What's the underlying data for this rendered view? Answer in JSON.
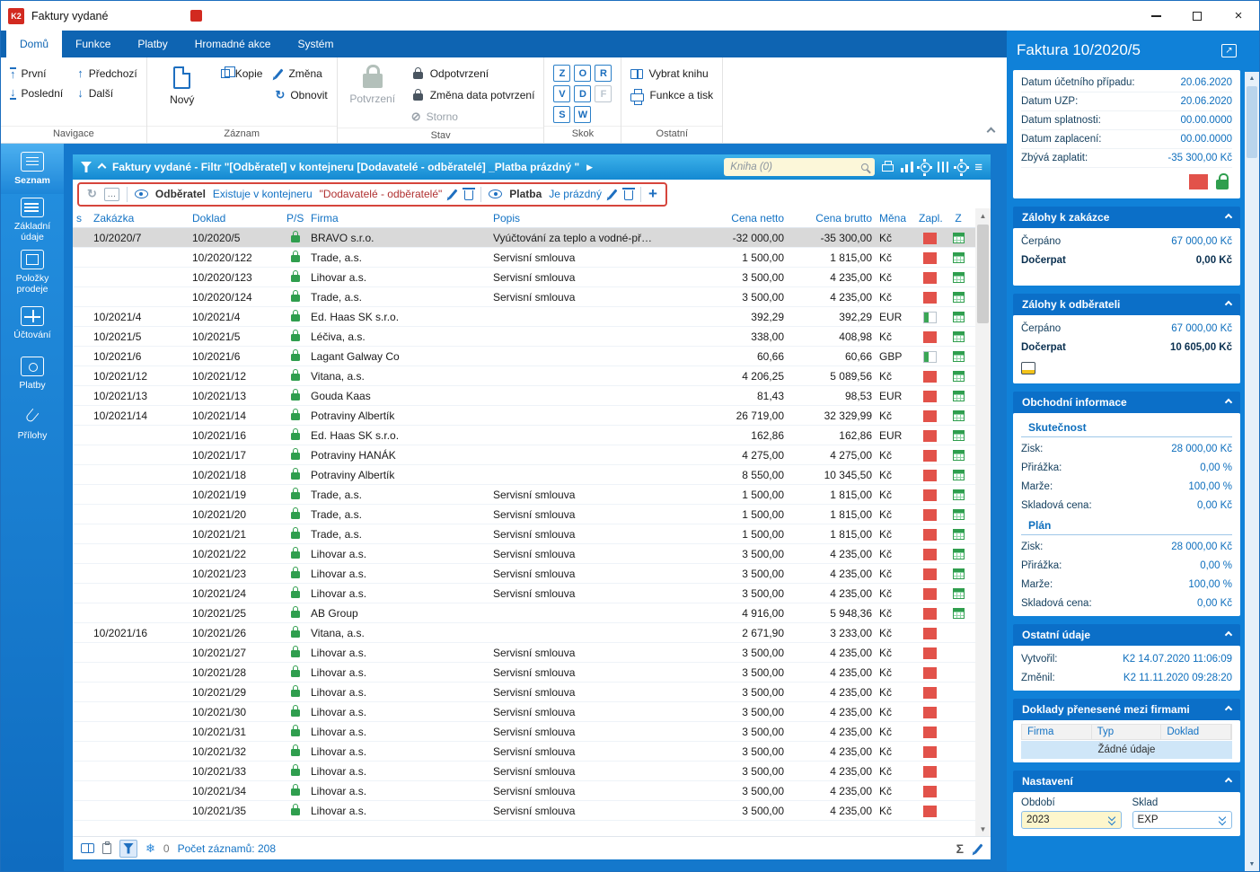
{
  "window": {
    "title": "Faktury vydané"
  },
  "colors": {
    "accent": "#1081d8",
    "ribbon_blue": "#0e64b2",
    "red_indicator": "#e2524a",
    "green_lock": "#2f9e4e",
    "filter_warning_border": "#d6453c",
    "selected_row": "#d9d9d9"
  },
  "ribbon": {
    "tabs": [
      "Domů",
      "Funkce",
      "Platby",
      "Hromadné akce",
      "Systém"
    ],
    "active_tab": "Domů",
    "navigace": {
      "label": "Navigace",
      "prvni": "První",
      "posledni": "Poslední",
      "predchozi": "Předchozí",
      "dalsi": "Další"
    },
    "zaznam": {
      "label": "Záznam",
      "novy": "Nový",
      "kopie": "Kopie",
      "zmena": "Změna",
      "obnovit": "Obnovit"
    },
    "stav": {
      "label": "Stav",
      "potvrzeni": "Potvrzení",
      "odpotvrzeni": "Odpotvrzení",
      "zmena_data": "Změna data potvrzení",
      "storno": "Storno"
    },
    "skok": {
      "label": "Skok",
      "keys": [
        {
          "label": "Z",
          "enabled": true
        },
        {
          "label": "O",
          "enabled": true
        },
        {
          "label": "R",
          "enabled": true
        },
        {
          "label": "V",
          "enabled": true
        },
        {
          "label": "D",
          "enabled": true
        },
        {
          "label": "F",
          "enabled": false
        },
        {
          "label": "S",
          "enabled": true
        },
        {
          "label": "W",
          "enabled": true
        }
      ]
    },
    "ostatni": {
      "label": "Ostatní",
      "vybrat_knihu": "Vybrat knihu",
      "funkce_a_tisk": "Funkce a tisk"
    }
  },
  "sidebar": {
    "items": [
      {
        "label": "Seznam",
        "icon": "list",
        "active": true
      },
      {
        "label": "Základní údaje",
        "icon": "detail",
        "active": false
      },
      {
        "label": "Položky prodeje",
        "icon": "items",
        "active": false
      },
      {
        "label": "Účtování",
        "icon": "grid",
        "active": false
      },
      {
        "label": "Platby",
        "icon": "money",
        "active": false
      },
      {
        "label": "Přílohy",
        "icon": "clip",
        "active": false
      }
    ]
  },
  "filterbar": {
    "title": "Faktury vydané - Filtr \"[Odběratel] v kontejneru [Dodavatelé - odběratelé] _Platba prázdný \"",
    "kniha": "Kniha (0)"
  },
  "conditions": {
    "dots": "…",
    "c1_field": "Odběratel",
    "c1_op": "Existuje v kontejneru",
    "c1_value": "\"Dodavatelé - odběratelé\"",
    "c2_field": "Platba",
    "c2_op": "Je prázdný",
    "add": "+"
  },
  "table": {
    "columns": [
      {
        "id": "s",
        "label": "s"
      },
      {
        "id": "zakazka",
        "label": "Zakázka"
      },
      {
        "id": "doklad",
        "label": "Doklad"
      },
      {
        "id": "ps",
        "label": "P/S"
      },
      {
        "id": "firma",
        "label": "Firma"
      },
      {
        "id": "popis",
        "label": "Popis"
      },
      {
        "id": "netto",
        "label": "Cena netto"
      },
      {
        "id": "brutto",
        "label": "Cena brutto"
      },
      {
        "id": "mena",
        "label": "Měna"
      },
      {
        "id": "zapl",
        "label": "Zapl."
      },
      {
        "id": "z",
        "label": "Z"
      }
    ],
    "rows": [
      {
        "zakazka": "10/2020/7",
        "doklad": "10/2020/5",
        "firma": "BRAVO s.r.o.",
        "popis": "Vyúčtování za teplo a vodné-př…",
        "netto": "-32 000,00",
        "brutto": "-35 300,00",
        "mena": "Kč",
        "zapl": "red",
        "z": true,
        "selected": true
      },
      {
        "zakazka": "",
        "doklad": "10/2020/122",
        "firma": "Trade, a.s.",
        "popis": "Servisní smlouva",
        "netto": "1 500,00",
        "brutto": "1 815,00",
        "mena": "Kč",
        "zapl": "red",
        "z": true
      },
      {
        "zakazka": "",
        "doklad": "10/2020/123",
        "firma": "Lihovar a.s.",
        "popis": "Servisní smlouva",
        "netto": "3 500,00",
        "brutto": "4 235,00",
        "mena": "Kč",
        "zapl": "red",
        "z": true
      },
      {
        "zakazka": "",
        "doklad": "10/2020/124",
        "firma": "Trade, a.s.",
        "popis": "Servisní smlouva",
        "netto": "3 500,00",
        "brutto": "4 235,00",
        "mena": "Kč",
        "zapl": "red",
        "z": true
      },
      {
        "zakazka": "10/2021/4",
        "doklad": "10/2021/4",
        "firma": "Ed. Haas SK s.r.o.",
        "popis": "",
        "netto": "392,29",
        "brutto": "392,29",
        "mena": "EUR",
        "zapl": "partial",
        "z": true
      },
      {
        "zakazka": "10/2021/5",
        "doklad": "10/2021/5",
        "firma": "Léčiva, a.s.",
        "popis": "",
        "netto": "338,00",
        "brutto": "408,98",
        "mena": "Kč",
        "zapl": "red",
        "z": true
      },
      {
        "zakazka": "10/2021/6",
        "doklad": "10/2021/6",
        "firma": "Lagant Galway Co",
        "popis": "",
        "netto": "60,66",
        "brutto": "60,66",
        "mena": "GBP",
        "zapl": "partial",
        "z": true
      },
      {
        "zakazka": "10/2021/12",
        "doklad": "10/2021/12",
        "firma": "Vitana, a.s.",
        "popis": "",
        "netto": "4 206,25",
        "brutto": "5 089,56",
        "mena": "Kč",
        "zapl": "red",
        "z": true
      },
      {
        "zakazka": "10/2021/13",
        "doklad": "10/2021/13",
        "firma": "Gouda Kaas",
        "popis": "",
        "netto": "81,43",
        "brutto": "98,53",
        "mena": "EUR",
        "zapl": "red",
        "z": true
      },
      {
        "zakazka": "10/2021/14",
        "doklad": "10/2021/14",
        "firma": "Potraviny Albertík",
        "popis": "",
        "netto": "26 719,00",
        "brutto": "32 329,99",
        "mena": "Kč",
        "zapl": "red",
        "z": true
      },
      {
        "zakazka": "",
        "doklad": "10/2021/16",
        "firma": "Ed. Haas SK s.r.o.",
        "popis": "",
        "netto": "162,86",
        "brutto": "162,86",
        "mena": "EUR",
        "zapl": "red",
        "z": true
      },
      {
        "zakazka": "",
        "doklad": "10/2021/17",
        "firma": "Potraviny HANÁK",
        "popis": "",
        "netto": "4 275,00",
        "brutto": "4 275,00",
        "mena": "Kč",
        "zapl": "red",
        "z": true
      },
      {
        "zakazka": "",
        "doklad": "10/2021/18",
        "firma": "Potraviny Albertík",
        "popis": "",
        "netto": "8 550,00",
        "brutto": "10 345,50",
        "mena": "Kč",
        "zapl": "red",
        "z": true
      },
      {
        "zakazka": "",
        "doklad": "10/2021/19",
        "firma": "Trade, a.s.",
        "popis": "Servisní smlouva",
        "netto": "1 500,00",
        "brutto": "1 815,00",
        "mena": "Kč",
        "zapl": "red",
        "z": true
      },
      {
        "zakazka": "",
        "doklad": "10/2021/20",
        "firma": "Trade, a.s.",
        "popis": "Servisní smlouva",
        "netto": "1 500,00",
        "brutto": "1 815,00",
        "mena": "Kč",
        "zapl": "red",
        "z": true
      },
      {
        "zakazka": "",
        "doklad": "10/2021/21",
        "firma": "Trade, a.s.",
        "popis": "Servisní smlouva",
        "netto": "1 500,00",
        "brutto": "1 815,00",
        "mena": "Kč",
        "zapl": "red",
        "z": true
      },
      {
        "zakazka": "",
        "doklad": "10/2021/22",
        "firma": "Lihovar a.s.",
        "popis": "Servisní smlouva",
        "netto": "3 500,00",
        "brutto": "4 235,00",
        "mena": "Kč",
        "zapl": "red",
        "z": true
      },
      {
        "zakazka": "",
        "doklad": "10/2021/23",
        "firma": "Lihovar a.s.",
        "popis": "Servisní smlouva",
        "netto": "3 500,00",
        "brutto": "4 235,00",
        "mena": "Kč",
        "zapl": "red",
        "z": true
      },
      {
        "zakazka": "",
        "doklad": "10/2021/24",
        "firma": "Lihovar a.s.",
        "popis": "Servisní smlouva",
        "netto": "3 500,00",
        "brutto": "4 235,00",
        "mena": "Kč",
        "zapl": "red",
        "z": true
      },
      {
        "zakazka": "",
        "doklad": "10/2021/25",
        "firma": "AB Group",
        "popis": "",
        "netto": "4 916,00",
        "brutto": "5 948,36",
        "mena": "Kč",
        "zapl": "red",
        "z": true
      },
      {
        "zakazka": "10/2021/16",
        "doklad": "10/2021/26",
        "firma": "Vitana, a.s.",
        "popis": "",
        "netto": "2 671,90",
        "brutto": "3 233,00",
        "mena": "Kč",
        "zapl": "red",
        "z": false
      },
      {
        "zakazka": "",
        "doklad": "10/2021/27",
        "firma": "Lihovar a.s.",
        "popis": "Servisní smlouva",
        "netto": "3 500,00",
        "brutto": "4 235,00",
        "mena": "Kč",
        "zapl": "red",
        "z": false
      },
      {
        "zakazka": "",
        "doklad": "10/2021/28",
        "firma": "Lihovar a.s.",
        "popis": "Servisní smlouva",
        "netto": "3 500,00",
        "brutto": "4 235,00",
        "mena": "Kč",
        "zapl": "red",
        "z": false
      },
      {
        "zakazka": "",
        "doklad": "10/2021/29",
        "firma": "Lihovar a.s.",
        "popis": "Servisní smlouva",
        "netto": "3 500,00",
        "brutto": "4 235,00",
        "mena": "Kč",
        "zapl": "red",
        "z": false
      },
      {
        "zakazka": "",
        "doklad": "10/2021/30",
        "firma": "Lihovar a.s.",
        "popis": "Servisní smlouva",
        "netto": "3 500,00",
        "brutto": "4 235,00",
        "mena": "Kč",
        "zapl": "red",
        "z": false
      },
      {
        "zakazka": "",
        "doklad": "10/2021/31",
        "firma": "Lihovar a.s.",
        "popis": "Servisní smlouva",
        "netto": "3 500,00",
        "brutto": "4 235,00",
        "mena": "Kč",
        "zapl": "red",
        "z": false
      },
      {
        "zakazka": "",
        "doklad": "10/2021/32",
        "firma": "Lihovar a.s.",
        "popis": "Servisní smlouva",
        "netto": "3 500,00",
        "brutto": "4 235,00",
        "mena": "Kč",
        "zapl": "red",
        "z": false
      },
      {
        "zakazka": "",
        "doklad": "10/2021/33",
        "firma": "Lihovar a.s.",
        "popis": "Servisní smlouva",
        "netto": "3 500,00",
        "brutto": "4 235,00",
        "mena": "Kč",
        "zapl": "red",
        "z": false
      },
      {
        "zakazka": "",
        "doklad": "10/2021/34",
        "firma": "Lihovar a.s.",
        "popis": "Servisní smlouva",
        "netto": "3 500,00",
        "brutto": "4 235,00",
        "mena": "Kč",
        "zapl": "red",
        "z": false
      },
      {
        "zakazka": "",
        "doklad": "10/2021/35",
        "firma": "Lihovar a.s.",
        "popis": "Servisní smlouva",
        "netto": "3 500,00",
        "brutto": "4 235,00",
        "mena": "Kč",
        "zapl": "red",
        "z": false
      }
    ]
  },
  "statusbar": {
    "flake_count": "0",
    "count_text": "Počet záznamů: 208"
  },
  "detail": {
    "title": "Faktura 10/2020/5",
    "dates": [
      {
        "label": "Datum účetního případu:",
        "value": "20.06.2020"
      },
      {
        "label": "Datum UZP:",
        "value": "20.06.2020"
      },
      {
        "label": "Datum splatnosti:",
        "value": "00.00.0000"
      },
      {
        "label": "Datum zaplacení:",
        "value": "00.00.0000"
      },
      {
        "label": "Zbývá zaplatit:",
        "value": "-35 300,00 Kč"
      }
    ],
    "zalohy_zakazka": {
      "title": "Zálohy k zakázce",
      "rows": [
        {
          "label": "Čerpáno",
          "value": "67 000,00 Kč"
        },
        {
          "label": "Dočerpat",
          "value": "0,00 Kč",
          "bold": true
        }
      ]
    },
    "zalohy_odberatel": {
      "title": "Zálohy k odběrateli",
      "rows": [
        {
          "label": "Čerpáno",
          "value": "67 000,00 Kč"
        },
        {
          "label": "Dočerpat",
          "value": "10 605,00 Kč",
          "bold": true
        }
      ]
    },
    "obchodni": {
      "title": "Obchodní informace",
      "skutecnost_label": "Skutečnost",
      "plan_label": "Plán",
      "skutecnost": [
        {
          "label": "Zisk:",
          "value": "28 000,00 Kč"
        },
        {
          "label": "Přirážka:",
          "value": "0,00 %"
        },
        {
          "label": "Marže:",
          "value": "100,00 %"
        },
        {
          "label": "Skladová cena:",
          "value": "0,00 Kč"
        }
      ],
      "plan": [
        {
          "label": "Zisk:",
          "value": "28 000,00 Kč"
        },
        {
          "label": "Přirážka:",
          "value": "0,00 %"
        },
        {
          "label": "Marže:",
          "value": "100,00 %"
        },
        {
          "label": "Skladová cena:",
          "value": "0,00 Kč"
        }
      ]
    },
    "ostatni_udaje": {
      "title": "Ostatní údaje",
      "rows": [
        {
          "label": "Vytvořil:",
          "value": "K2 14.07.2020 11:06:09"
        },
        {
          "label": "Změnil:",
          "value": "K2 11.11.2020 09:28:20"
        }
      ]
    },
    "doklady": {
      "title": "Doklady přenesené mezi firmami",
      "columns": [
        "Firma",
        "Typ",
        "Doklad"
      ],
      "empty": "Žádné údaje"
    },
    "nastaveni": {
      "title": "Nastavení",
      "obdobi_label": "Období",
      "obdobi_value": "2023",
      "sklad_label": "Sklad",
      "sklad_value": "EXP"
    }
  }
}
